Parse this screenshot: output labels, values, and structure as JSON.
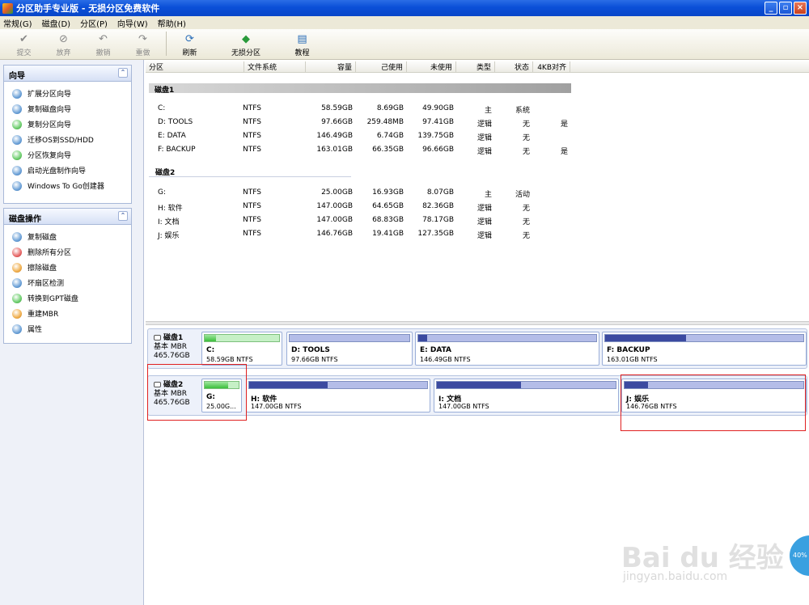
{
  "window": {
    "title": "分区助手专业版 - 无损分区免费软件"
  },
  "menu": [
    "常规(G)",
    "磁盘(D)",
    "分区(P)",
    "向导(W)",
    "帮助(H)"
  ],
  "toolbar": {
    "commit": "提交",
    "discard": "放弃",
    "undo": "撤销",
    "redo": "重做",
    "refresh": "刷新",
    "lossless": "无损分区",
    "tutorial": "教程"
  },
  "wizard_panel": {
    "title": "向导",
    "items": [
      "扩展分区向导",
      "复制磁盘向导",
      "复制分区向导",
      "迁移OS到SSD/HDD",
      "分区恢复向导",
      "启动光盘制作向导",
      "Windows To Go创建器"
    ]
  },
  "disk_ops_panel": {
    "title": "磁盘操作",
    "items": [
      "复制磁盘",
      "删除所有分区",
      "擦除磁盘",
      "坏扇区检测",
      "转换到GPT磁盘",
      "重建MBR",
      "属性"
    ]
  },
  "table": {
    "headers": [
      "分区",
      "文件系统",
      "容量",
      "己使用",
      "未使用",
      "类型",
      "状态",
      "4KB对齐"
    ],
    "disk1_label": "磁盘1",
    "disk2_label": "磁盘2",
    "disk1_rows": [
      [
        "C:",
        "NTFS",
        "58.59GB",
        "8.69GB",
        "49.90GB",
        "主",
        "系统",
        ""
      ],
      [
        "D: TOOLS",
        "NTFS",
        "97.66GB",
        "259.48MB",
        "97.41GB",
        "逻辑",
        "无",
        "是"
      ],
      [
        "E: DATA",
        "NTFS",
        "146.49GB",
        "6.74GB",
        "139.75GB",
        "逻辑",
        "无",
        ""
      ],
      [
        "F: BACKUP",
        "NTFS",
        "163.01GB",
        "66.35GB",
        "96.66GB",
        "逻辑",
        "无",
        "是"
      ]
    ],
    "disk2_rows": [
      [
        "G:",
        "NTFS",
        "25.00GB",
        "16.93GB",
        "8.07GB",
        "主",
        "活动",
        ""
      ],
      [
        "H: 软件",
        "NTFS",
        "147.00GB",
        "64.65GB",
        "82.36GB",
        "逻辑",
        "无",
        ""
      ],
      [
        "I: 文档",
        "NTFS",
        "147.00GB",
        "68.83GB",
        "78.17GB",
        "逻辑",
        "无",
        ""
      ],
      [
        "J: 娱乐",
        "NTFS",
        "146.76GB",
        "19.41GB",
        "127.35GB",
        "逻辑",
        "无",
        ""
      ]
    ]
  },
  "disk_map": {
    "disk1": {
      "name": "磁盘1",
      "type": "基本 MBR",
      "size": "465.76GB",
      "parts": [
        {
          "name": "C:",
          "info": "58.59GB NTFS",
          "used_frac": 0.15
        },
        {
          "name": "D: TOOLS",
          "info": "97.66GB NTFS",
          "used_frac": 0.0
        },
        {
          "name": "E: DATA",
          "info": "146.49GB NTFS",
          "used_frac": 0.05
        },
        {
          "name": "F: BACKUP",
          "info": "163.01GB NTFS",
          "used_frac": 0.41
        }
      ]
    },
    "disk2": {
      "name": "磁盘2",
      "type": "基本 MBR",
      "size": "465.76GB",
      "parts": [
        {
          "name": "G:",
          "info": "25.00G...",
          "used_frac": 0.68
        },
        {
          "name": "H: 软件",
          "info": "147.00GB NTFS",
          "used_frac": 0.44
        },
        {
          "name": "I: 文档",
          "info": "147.00GB NTFS",
          "used_frac": 0.47
        },
        {
          "name": "J: 娱乐",
          "info": "146.76GB NTFS",
          "used_frac": 0.13
        }
      ]
    }
  },
  "watermark": {
    "text": "Bai du 经验",
    "url": "jingyan.baidu.com",
    "badge": "40%"
  },
  "colors": {
    "used_bar": "#3b4aa0",
    "free_bar": "#b4bde8",
    "primary_used": "#3bbf3b",
    "highlight": "#e02020"
  }
}
